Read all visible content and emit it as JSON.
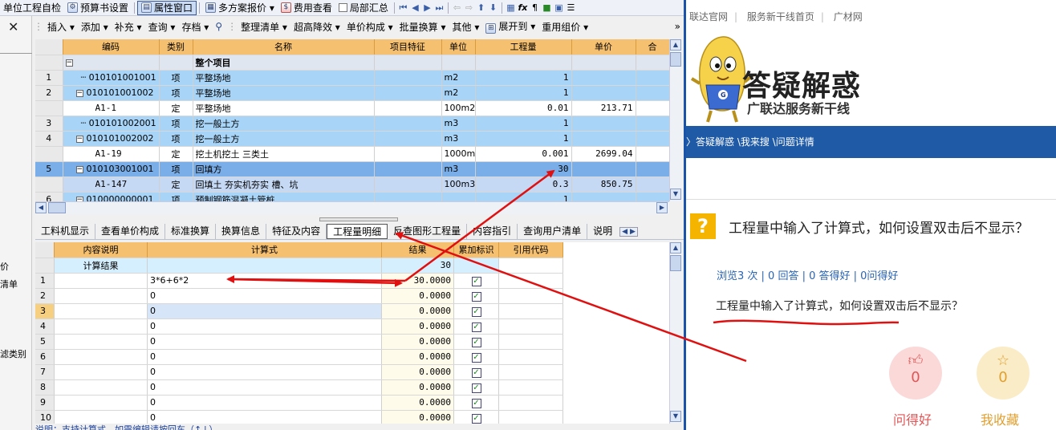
{
  "toolbar1": {
    "items": [
      "单位工程自检",
      "预算书设置",
      "属性窗口",
      "多方案报价",
      "费用查看",
      "局部汇总"
    ],
    "fx": "fx",
    "para": "¶"
  },
  "toolbar2": {
    "items": [
      "插入",
      "添加",
      "补充",
      "查询",
      "存档",
      "整理清单",
      "超高降效",
      "单价构成",
      "批量换算",
      "其他",
      "展开到",
      "重用组价"
    ],
    "more": "»"
  },
  "left_strip": {
    "close": "✕",
    "labels": [
      "价",
      "清单",
      "滤类别"
    ]
  },
  "grid1": {
    "headers": [
      "编码",
      "类别",
      "名称",
      "项目特征",
      "单位",
      "工程量",
      "单价",
      "合"
    ],
    "rows": [
      {
        "rn": "",
        "code": "",
        "type": "",
        "name": "整个项目",
        "unit": "",
        "qty": "",
        "price": ""
      },
      {
        "rn": "1",
        "code": "010101001001",
        "type": "项",
        "name": "平整场地",
        "unit": "m2",
        "qty": "1",
        "price": ""
      },
      {
        "rn": "2",
        "code": "010101001002",
        "type": "项",
        "name": "平整场地",
        "unit": "m2",
        "qty": "1",
        "price": ""
      },
      {
        "rn": "",
        "code": "A1-1",
        "type": "定",
        "name": "平整场地",
        "unit": "100m2",
        "qty": "0.01",
        "price": "213.71"
      },
      {
        "rn": "3",
        "code": "010101002001",
        "type": "项",
        "name": "挖一般土方",
        "unit": "m3",
        "qty": "1",
        "price": ""
      },
      {
        "rn": "4",
        "code": "010101002002",
        "type": "项",
        "name": "挖一般土方",
        "unit": "m3",
        "qty": "1",
        "price": ""
      },
      {
        "rn": "",
        "code": "A1-19",
        "type": "定",
        "name": "挖土机挖土 三类土",
        "unit": "1000m3",
        "qty": "0.001",
        "price": "2699.04"
      },
      {
        "rn": "5",
        "code": "010103001001",
        "type": "项",
        "name": "回填方",
        "unit": "m3",
        "qty": "30",
        "price": ""
      },
      {
        "rn": "",
        "code": "A1-147",
        "type": "定",
        "name": "回填土 夯实机夯实 槽、坑",
        "unit": "100m3",
        "qty": "0.3",
        "price": "850.75"
      },
      {
        "rn": "6",
        "code": "010000000001",
        "type": "项",
        "name": "预制钢筋混凝土管桩",
        "unit": "",
        "qty": "1",
        "price": ""
      }
    ]
  },
  "tabs": [
    "工料机显示",
    "查看单价构成",
    "标准换算",
    "换算信息",
    "特征及内容",
    "工程量明细",
    "反查图形工程量",
    "内容指引",
    "查询用户清单",
    "说明"
  ],
  "grid2": {
    "headers": [
      "内容说明",
      "计算式",
      "结果",
      "累加标识",
      "引用代码"
    ],
    "result_row": {
      "label": "计算结果",
      "value": "30"
    },
    "rows": [
      {
        "rn": "1",
        "formula": "3*6+6*2",
        "result": "30.0000"
      },
      {
        "rn": "2",
        "formula": "0",
        "result": "0.0000"
      },
      {
        "rn": "3",
        "formula": "0",
        "result": "0.0000"
      },
      {
        "rn": "4",
        "formula": "0",
        "result": "0.0000"
      },
      {
        "rn": "5",
        "formula": "0",
        "result": "0.0000"
      },
      {
        "rn": "6",
        "formula": "0",
        "result": "0.0000"
      },
      {
        "rn": "7",
        "formula": "0",
        "result": "0.0000"
      },
      {
        "rn": "8",
        "formula": "0",
        "result": "0.0000"
      },
      {
        "rn": "9",
        "formula": "0",
        "result": "0.0000"
      },
      {
        "rn": "10",
        "formula": "0",
        "result": "0.0000"
      }
    ]
  },
  "status": "说明：支持计算式，如需编辑请按回车（↑↓）",
  "web": {
    "toplinks": [
      "联达官网",
      "服务新干线首页",
      "广材网"
    ],
    "brand_title": "答疑解惑",
    "brand_sub": "广联达服务新干线",
    "breadcrumb": "〉答疑解惑 \\我来搜 \\问题详情",
    "question_title": "工程量中输入了计算式，如何设置双击后不显示？",
    "stats": "浏览3 次 | 0 回答 | 0 答得好 | 0问得好",
    "question_body": "工程量中输入了计算式，如何设置双击后不显示？",
    "like_count": "0",
    "fav_count": "0",
    "like_label": "问得好",
    "fav_label": "我收藏"
  },
  "colors": {
    "header_orange": "#f6c071",
    "row_blue": "#a8d4f7",
    "selected_blue": "#7aaee8",
    "arrow_red": "#e01010",
    "nav_blue": "#1f5aa6",
    "question_yellow": "#f5b400"
  }
}
